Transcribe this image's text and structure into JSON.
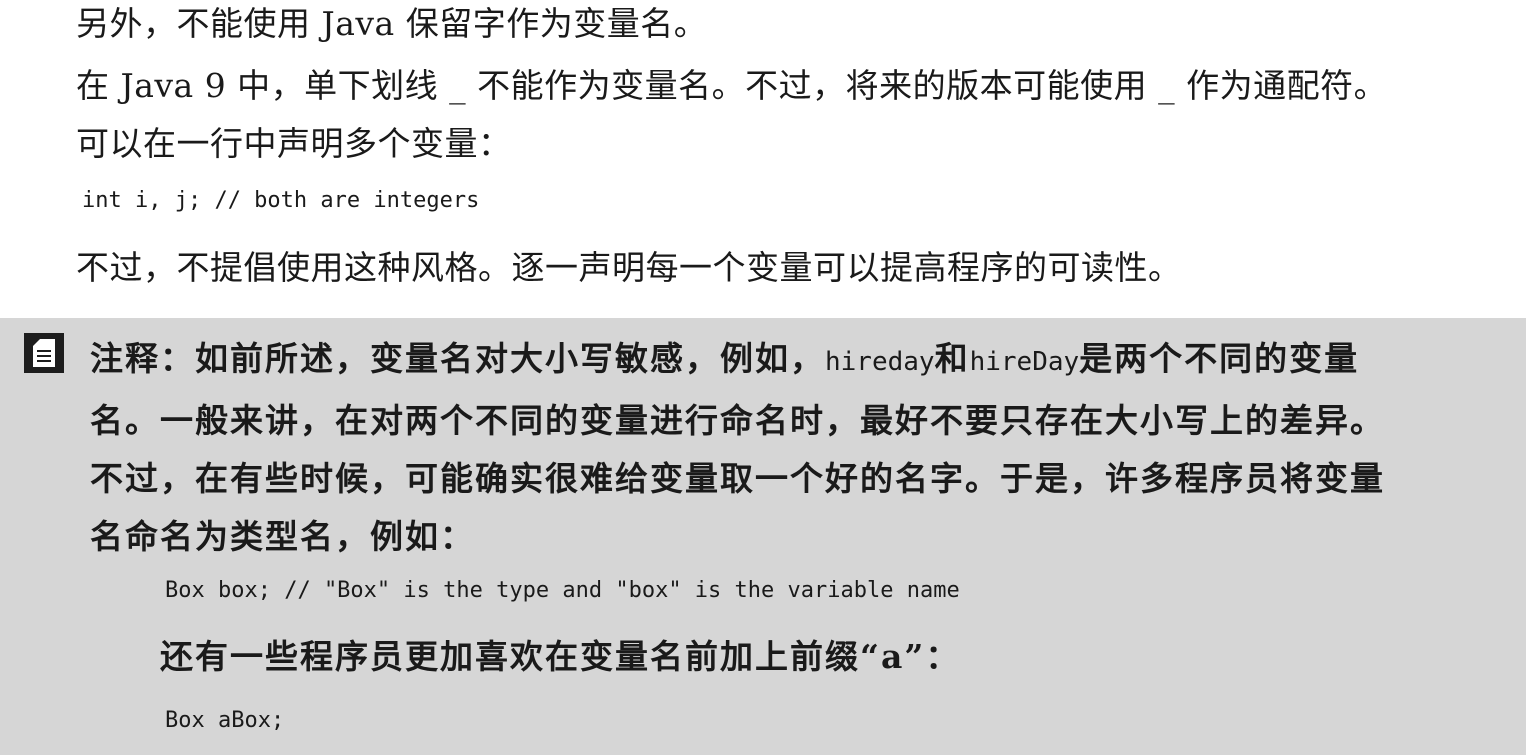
{
  "body": {
    "p1": "另外，不能使用 Java 保留字作为变量名。",
    "p2": "在 Java 9 中，单下划线 _ 不能作为变量名。不过，将来的版本可能使用 _ 作为通配符。",
    "p3": "可以在一行中声明多个变量：",
    "code1": "int i, j; // both are integers",
    "p4": "不过，不提倡使用这种风格。逐一声明每一个变量可以提高程序的可读性。"
  },
  "note": {
    "icon": "note-icon",
    "label": "注释：",
    "line1_a": "如前所述，变量名对大小写敏感，例如，",
    "line1_code1": "hireday",
    "line1_b": "和",
    "line1_code2": "hireDay",
    "line1_c": "是两个不同的变量",
    "line2": "名。一般来讲，在对两个不同的变量进行命名时，最好不要只存在大小写上的差异。",
    "line3": "不过，在有些时候，可能确实很难给变量取一个好的名字。于是，许多程序员将变量",
    "line4": "名命名为类型名，例如：",
    "code2": "Box box; // \"Box\" is the type and \"box\" is the variable name",
    "line5": "还有一些程序员更加喜欢在变量名前加上前缀“a”：",
    "code3": "Box aBox;"
  },
  "colors": {
    "note_background": "#d6d6d6",
    "text": "#1a1a1a"
  }
}
